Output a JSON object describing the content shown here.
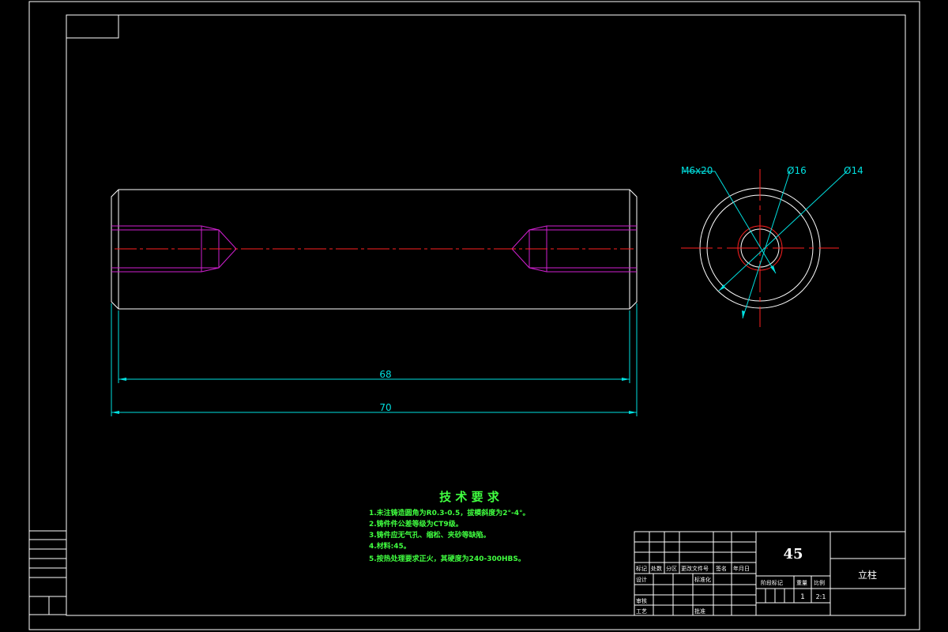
{
  "drawing": {
    "dim_68": "68",
    "dim_70": "70",
    "thread_label": "M6x20",
    "dia_16": "Ø16",
    "dia_14": "Ø14"
  },
  "requirements": {
    "title": "技 术 要 求",
    "items": [
      "1.未注铸造圆角为R0.3-0.5，拔模斜度为2°-4°。",
      "2.铸件件公差等级为CT9级。",
      "3.铸件应无气孔、缩松、夹砂等缺陷。",
      "4.材料:45。",
      "5.按热处理要求正火，其硬度为240-300HBS。"
    ]
  },
  "title_block": {
    "material": "45",
    "part_name": "立柱",
    "quantity": "1",
    "scale": "2:1",
    "labels": {
      "mark": "标记",
      "count": "处数",
      "zone": "分区",
      "change_doc": "更改文件号",
      "signature": "签名",
      "date": "年月日",
      "design": "设计",
      "standardize": "标准化",
      "review": "审核",
      "process": "工艺",
      "approve": "批准",
      "stage_mark": "阶段标记",
      "weight": "重量",
      "ratio": "比例"
    }
  }
}
